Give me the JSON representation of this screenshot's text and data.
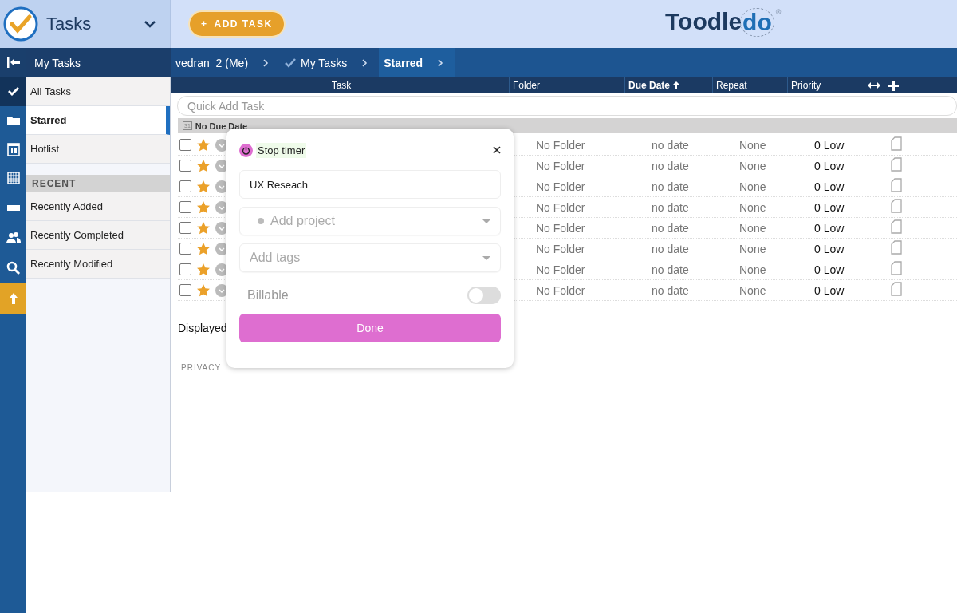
{
  "app": {
    "title": "Tasks",
    "add_button": {
      "icon": "+",
      "label": "ADD TASK"
    },
    "logo": {
      "text": "Toodle",
      "accent": "do",
      "mark": "®"
    }
  },
  "rail": [
    {
      "kind": "collapse"
    },
    {
      "kind": "check",
      "selected": true
    },
    {
      "kind": "folder",
      "selected": false
    },
    {
      "kind": "calendar",
      "selected": false
    },
    {
      "kind": "grid",
      "selected": false
    },
    {
      "kind": "card",
      "selected": false
    },
    {
      "kind": "people",
      "selected": false
    },
    {
      "kind": "search",
      "selected": false
    },
    {
      "kind": "upload"
    }
  ],
  "sidebar": {
    "title": "My Tasks",
    "items": [
      {
        "label": "All Tasks",
        "selected": false
      },
      {
        "label": "Starred",
        "selected": true
      },
      {
        "label": "Hotlist",
        "selected": false
      }
    ],
    "section": "RECENT",
    "recent": [
      {
        "label": "Recently Added",
        "selected": false
      },
      {
        "label": "Recently Completed",
        "selected": false
      },
      {
        "label": "Recently Modified",
        "selected": false
      }
    ]
  },
  "breadcrumb": [
    {
      "label": "vedran_2 (Me)",
      "check": false,
      "selected": false
    },
    {
      "label": "My Tasks",
      "check": true,
      "selected": false
    },
    {
      "label": "Starred",
      "check": false,
      "selected": true
    }
  ],
  "table": {
    "columns": [
      {
        "label": "Task",
        "sorted": false
      },
      {
        "label": "Folder",
        "sorted": false
      },
      {
        "label": "Due Date",
        "sorted": true
      },
      {
        "label": "Repeat",
        "sorted": false
      },
      {
        "label": "Priority",
        "sorted": false
      }
    ],
    "quick_add": {
      "placeholder": "Quick Add Task"
    },
    "group": {
      "icon_text": "31",
      "label": "No Due Date"
    },
    "rows": [
      {
        "checked": false,
        "starred": true,
        "folder": "No Folder",
        "due": "no date",
        "repeat": "None",
        "priority": "0 Low"
      },
      {
        "checked": false,
        "starred": true,
        "folder": "No Folder",
        "due": "no date",
        "repeat": "None",
        "priority": "0 Low"
      },
      {
        "checked": false,
        "starred": true,
        "folder": "No Folder",
        "due": "no date",
        "repeat": "None",
        "priority": "0 Low"
      },
      {
        "checked": false,
        "starred": true,
        "folder": "No Folder",
        "due": "no date",
        "repeat": "None",
        "priority": "0 Low"
      },
      {
        "checked": false,
        "starred": true,
        "folder": "No Folder",
        "due": "no date",
        "repeat": "None",
        "priority": "0 Low"
      },
      {
        "checked": false,
        "starred": true,
        "folder": "No Folder",
        "due": "no date",
        "repeat": "None",
        "priority": "0 Low"
      },
      {
        "checked": false,
        "starred": true,
        "folder": "No Folder",
        "due": "no date",
        "repeat": "None",
        "priority": "0 Low"
      },
      {
        "checked": false,
        "starred": true,
        "folder": "No Folder",
        "due": "no date",
        "repeat": "None",
        "priority": "0 Low"
      }
    ],
    "summary": "Displayed"
  },
  "footer": [
    "PRIVACY"
  ],
  "timer_popup": {
    "timer_label": "Stop timer",
    "description": "UX Reseach",
    "project": {
      "placeholder": "Add project"
    },
    "tags": {
      "placeholder": "Add tags"
    },
    "billable": {
      "label": "Billable",
      "on": false
    },
    "done": "Done"
  }
}
